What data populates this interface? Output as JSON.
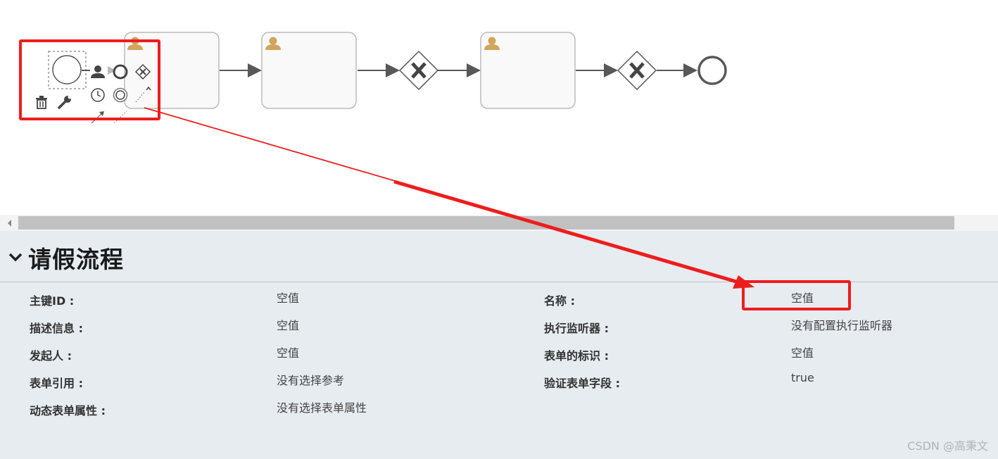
{
  "process": {
    "name": "请假流程"
  },
  "properties": {
    "left": [
      {
        "label": "主键ID :",
        "value": "空值"
      },
      {
        "label": "描述信息 :",
        "value": "空值"
      },
      {
        "label": "发起人 :",
        "value": "空值"
      },
      {
        "label": "表单引用 :",
        "value": "没有选择参考"
      },
      {
        "label": "动态表单属性 :",
        "value": "没有选择表单属性"
      }
    ],
    "right": [
      {
        "label": "名称 :",
        "value": "空值"
      },
      {
        "label": "执行监听器 :",
        "value": "没有配置执行监听器"
      },
      {
        "label": "表单的标识 :",
        "value": "空值"
      },
      {
        "label": "验证表单字段 :",
        "value": "true"
      }
    ]
  },
  "watermark": "CSDN @高秉文",
  "colors": {
    "annotation_red": "#ee1d1d",
    "task_border": "#bbbbbb",
    "user_icon": "#d1a55a",
    "panel_bg": "#e7ecf1"
  },
  "icons": [
    "user-task-icon",
    "exclusive-gateway-icon",
    "trash-icon",
    "wrench-icon",
    "chevron-down-icon"
  ]
}
